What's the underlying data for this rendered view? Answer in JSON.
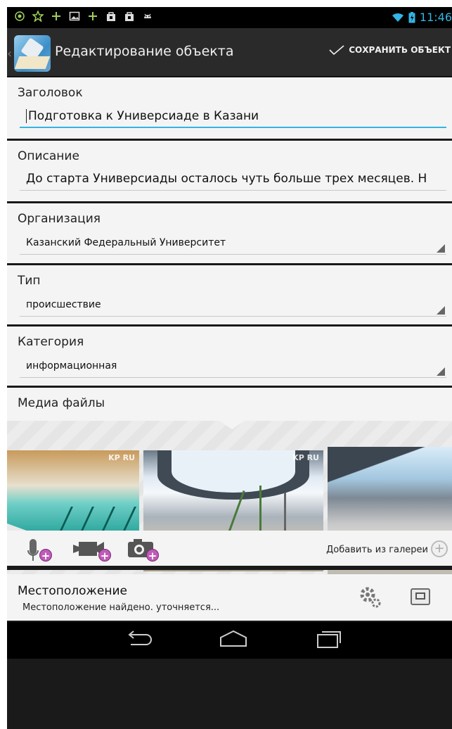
{
  "status_bar": {
    "left_icons": [
      "location-target-icon",
      "star-icon",
      "plus-icon",
      "image-icon",
      "plus-icon",
      "shopping-bag-icon",
      "shopping-bag-icon",
      "android-icon"
    ],
    "time": "11:46",
    "wifi_icon": "wifi-icon",
    "battery_icon": "battery-charging-icon",
    "accent": "#33b5e5",
    "notif_color": "#9ed05a"
  },
  "action_bar": {
    "title": "Редактирование объекта",
    "save_label": "СОХРАНИТЬ ОБЪЕКТ"
  },
  "fields": {
    "title": {
      "label": "Заголовок",
      "value": "Подготовка к Универсиаде в Казани"
    },
    "description": {
      "label": "Описание",
      "value_before": "До  старта Универсиады осталось чуть больше ",
      "value_misspelled": "трех",
      "value_after": " месяцев. Н"
    },
    "organization": {
      "label": "Организация",
      "value": "Казанский Федеральный Университет"
    },
    "type": {
      "label": "Тип",
      "value": "происшествие"
    },
    "category": {
      "label": "Категория",
      "value": "информационная"
    }
  },
  "media": {
    "label": "Медиа файлы",
    "thumbs": [
      {
        "name": "media-thumb-pool",
        "watermark": "KP RU"
      },
      {
        "name": "media-thumb-stadium",
        "watermark": "KP RU"
      },
      {
        "name": "media-thumb-stands",
        "watermark": ""
      }
    ],
    "add_from_gallery": "Добавить из галереи",
    "actions": [
      "add-audio-icon",
      "add-video-icon",
      "add-photo-icon"
    ]
  },
  "location": {
    "title": "Местоположение",
    "status": "Местоположение найдено. уточняется..."
  },
  "nav_bar": {
    "buttons": [
      "back-icon",
      "home-icon",
      "recents-icon"
    ]
  }
}
